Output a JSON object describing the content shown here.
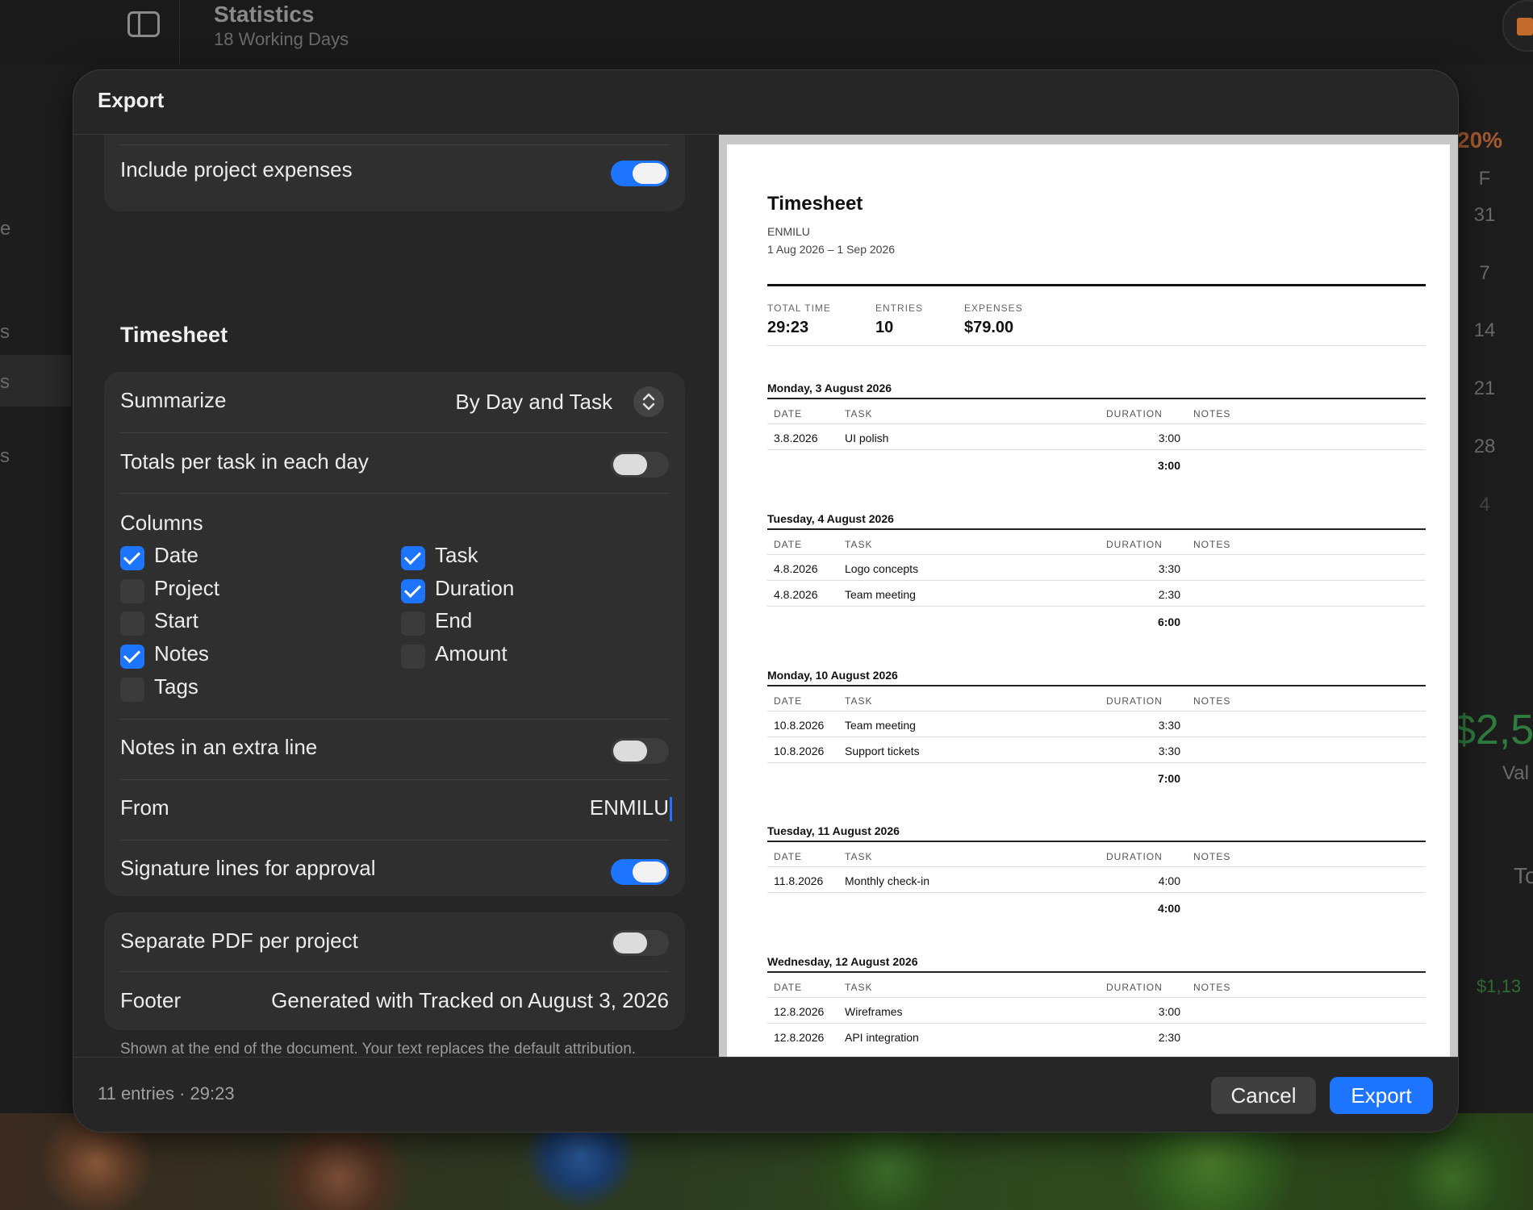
{
  "background": {
    "title": "Statistics",
    "subtitle": "18 Working Days",
    "left_texts": [
      "e",
      "s",
      "s",
      "s"
    ],
    "percent": "20%",
    "weekday": "F",
    "calendar_days": [
      "31",
      "7",
      "14",
      "21",
      "28",
      "4"
    ],
    "big_value": "$2,5",
    "value_label": "Val",
    "t_letter": "To",
    "small_value": "$1,13"
  },
  "dialog": {
    "title": "Export",
    "expenses": {
      "label": "Include project expenses",
      "on": true
    },
    "timesheet_section": "Timesheet",
    "summarize": {
      "label": "Summarize",
      "value": "By Day and Task"
    },
    "totals_per_task": {
      "label": "Totals per task in each day",
      "on": false
    },
    "columns_label": "Columns",
    "columns": [
      {
        "label": "Date",
        "checked": true
      },
      {
        "label": "Task",
        "checked": true
      },
      {
        "label": "Project",
        "checked": false
      },
      {
        "label": "Duration",
        "checked": true
      },
      {
        "label": "Start",
        "checked": false
      },
      {
        "label": "End",
        "checked": false
      },
      {
        "label": "Notes",
        "checked": true
      },
      {
        "label": "Amount",
        "checked": false
      },
      {
        "label": "Tags",
        "checked": false
      }
    ],
    "notes_extra_line": {
      "label": "Notes in an extra line",
      "on": false
    },
    "from": {
      "label": "From",
      "value": "ENMILU"
    },
    "signature": {
      "label": "Signature lines for approval",
      "on": true
    },
    "separate_pdf": {
      "label": "Separate PDF per project",
      "on": false
    },
    "footer": {
      "label": "Footer",
      "value": "Generated with Tracked on August 3, 2026"
    },
    "helper_text": "Shown at the end of the document. Your text replaces the default attribution.",
    "summary": "11 entries · 29:23",
    "cancel_label": "Cancel",
    "export_label": "Export"
  },
  "preview": {
    "title": "Timesheet",
    "from": "ENMILU",
    "range": "1 Aug 2026 – 1 Sep 2026",
    "stats": [
      {
        "label": "TOTAL TIME",
        "value": "29:23"
      },
      {
        "label": "ENTRIES",
        "value": "10"
      },
      {
        "label": "EXPENSES",
        "value": "$79.00"
      }
    ],
    "headers": {
      "date": "DATE",
      "task": "TASK",
      "duration": "DURATION",
      "notes": "NOTES"
    },
    "days": [
      {
        "title": "Monday, 3 August 2026",
        "rows": [
          {
            "date": "3.8.2026",
            "task": "UI polish",
            "duration": "3:00"
          }
        ],
        "total": "3:00"
      },
      {
        "title": "Tuesday, 4 August 2026",
        "rows": [
          {
            "date": "4.8.2026",
            "task": "Logo concepts",
            "duration": "3:30"
          },
          {
            "date": "4.8.2026",
            "task": "Team meeting",
            "duration": "2:30"
          }
        ],
        "total": "6:00"
      },
      {
        "title": "Monday, 10 August 2026",
        "rows": [
          {
            "date": "10.8.2026",
            "task": "Team meeting",
            "duration": "3:30"
          },
          {
            "date": "10.8.2026",
            "task": "Support tickets",
            "duration": "3:30"
          }
        ],
        "total": "7:00"
      },
      {
        "title": "Tuesday, 11 August 2026",
        "rows": [
          {
            "date": "11.8.2026",
            "task": "Monthly check-in",
            "duration": "4:00"
          }
        ],
        "total": "4:00"
      },
      {
        "title": "Wednesday, 12 August 2026",
        "rows": [
          {
            "date": "12.8.2026",
            "task": "Wireframes",
            "duration": "3:00"
          },
          {
            "date": "12.8.2026",
            "task": "API integration",
            "duration": "2:30"
          }
        ],
        "total": ""
      }
    ]
  }
}
